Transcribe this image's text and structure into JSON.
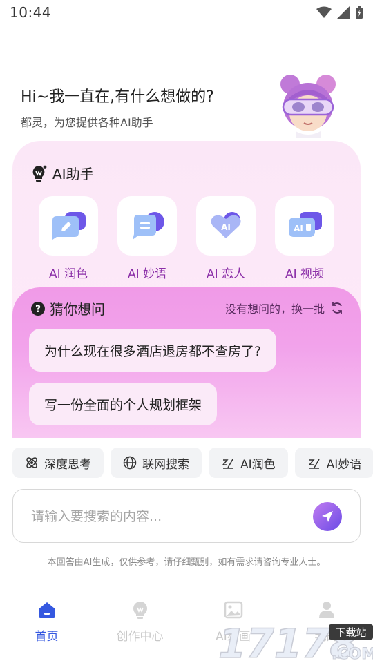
{
  "status_bar": {
    "time": "10:44"
  },
  "greeting": {
    "title": "Hi~我一直在,有什么想做的?",
    "subtitle": "都灵，为您提供各种AI助手"
  },
  "assistant": {
    "title": "AI助手",
    "tools": [
      {
        "label": "AI 润色",
        "icon": "pen-icon"
      },
      {
        "label": "AI 妙语",
        "icon": "chat-bubble-icon"
      },
      {
        "label": "AI 恋人",
        "icon": "heart-icon"
      },
      {
        "label": "AI 视频",
        "icon": "video-icon"
      }
    ]
  },
  "guess": {
    "title": "猜你想问",
    "refresh_label": "没有想问的，换一批",
    "questions": [
      "为什么现在很多酒店退房都不查房了?",
      "写一份全面的个人规划框架"
    ]
  },
  "chips": [
    {
      "label": "深度思考",
      "icon": "atom-icon"
    },
    {
      "label": "联网搜索",
      "icon": "globe-icon"
    },
    {
      "label": "AI润色",
      "icon": "pen-icon"
    },
    {
      "label": "AI妙语",
      "icon": "pen-icon"
    }
  ],
  "search": {
    "placeholder": "请输入要搜索的内容..."
  },
  "disclaimer": "本回答由AI生成，仅供参考，请仔细甄别，如有需求请咨询专业人士。",
  "bottom_nav": [
    {
      "label": "首页",
      "icon": "home-icon",
      "active": true
    },
    {
      "label": "创作中心",
      "icon": "bulb-icon",
      "active": false
    },
    {
      "label": "AI绘画",
      "icon": "image-icon",
      "active": false
    },
    {
      "label": "我的",
      "icon": "user-icon",
      "active": false
    }
  ],
  "watermark": {
    "number": "17178",
    "tag": "下载站",
    "domain": ".COM"
  },
  "colors": {
    "accent": "#3558e0",
    "tool_label": "#8b2fa8",
    "card_pink": "#f09ae7"
  }
}
